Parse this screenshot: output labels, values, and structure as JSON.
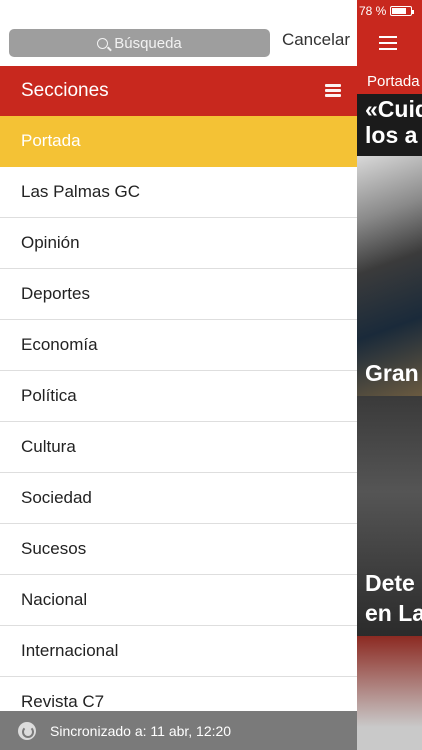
{
  "status_bar": {
    "battery_text": "78 %"
  },
  "peek": {
    "section_label": "Portada",
    "headlines": [
      "«Cuid",
      "los a",
      "Gran",
      "Dete",
      "en La"
    ]
  },
  "search": {
    "placeholder": "Búsqueda",
    "cancel_label": "Cancelar"
  },
  "sections": {
    "title": "Secciones",
    "items": [
      {
        "label": "Portada",
        "active": true
      },
      {
        "label": "Las Palmas GC"
      },
      {
        "label": "Opinión"
      },
      {
        "label": "Deportes"
      },
      {
        "label": "Economía"
      },
      {
        "label": "Política"
      },
      {
        "label": "Cultura"
      },
      {
        "label": "Sociedad"
      },
      {
        "label": "Sucesos"
      },
      {
        "label": "Nacional"
      },
      {
        "label": "Internacional"
      },
      {
        "label": "Revista C7"
      }
    ]
  },
  "sync": {
    "text": "Sincronizado a: 11 abr, 12:20"
  },
  "colors": {
    "brand_red": "#c8281e",
    "active_yellow": "#f4c235",
    "footer_gray": "#7a7a7a"
  }
}
